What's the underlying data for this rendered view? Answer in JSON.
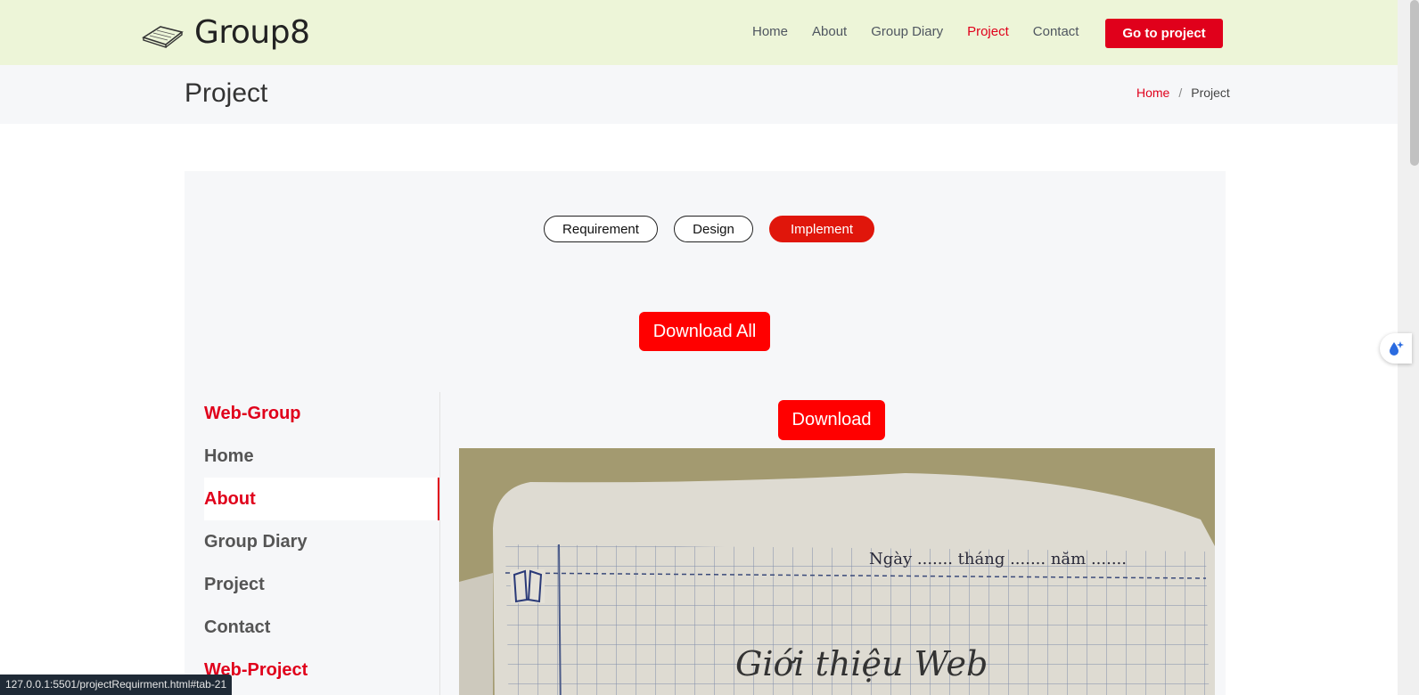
{
  "header": {
    "brand": "Group8",
    "logo_icon": "book-icon",
    "nav": [
      {
        "label": "Home",
        "active": false
      },
      {
        "label": "About",
        "active": false
      },
      {
        "label": "Group Diary",
        "active": false
      },
      {
        "label": "Project",
        "active": true
      },
      {
        "label": "Contact",
        "active": false
      }
    ],
    "cta_label": "Go to project"
  },
  "page": {
    "title": "Project",
    "breadcrumb": {
      "home": "Home",
      "separator": "/",
      "current": "Project"
    }
  },
  "tabs": [
    {
      "label": "Requirement",
      "active": false
    },
    {
      "label": "Design",
      "active": false
    },
    {
      "label": "Implement",
      "active": true
    }
  ],
  "download_all_label": "Download All",
  "download_label": "Download",
  "sidebar": {
    "items": [
      {
        "label": "Web-Group",
        "type": "heading"
      },
      {
        "label": "Home",
        "type": "item"
      },
      {
        "label": "About",
        "type": "item",
        "active": true
      },
      {
        "label": "Group Diary",
        "type": "item"
      },
      {
        "label": "Project",
        "type": "item"
      },
      {
        "label": "Contact",
        "type": "item"
      },
      {
        "label": "Web-Project",
        "type": "heading"
      }
    ]
  },
  "notebook_image": {
    "header_text": "Ngày ....... tháng ....... năm .......",
    "handwriting": "Giới thiệu Web"
  },
  "status_url": "127.0.0.1:5501/projectRequirment.html#tab-21",
  "colors": {
    "accent": "#e0001b",
    "header_bg": "#edf5d8",
    "panel_bg": "#f6f7f9"
  }
}
